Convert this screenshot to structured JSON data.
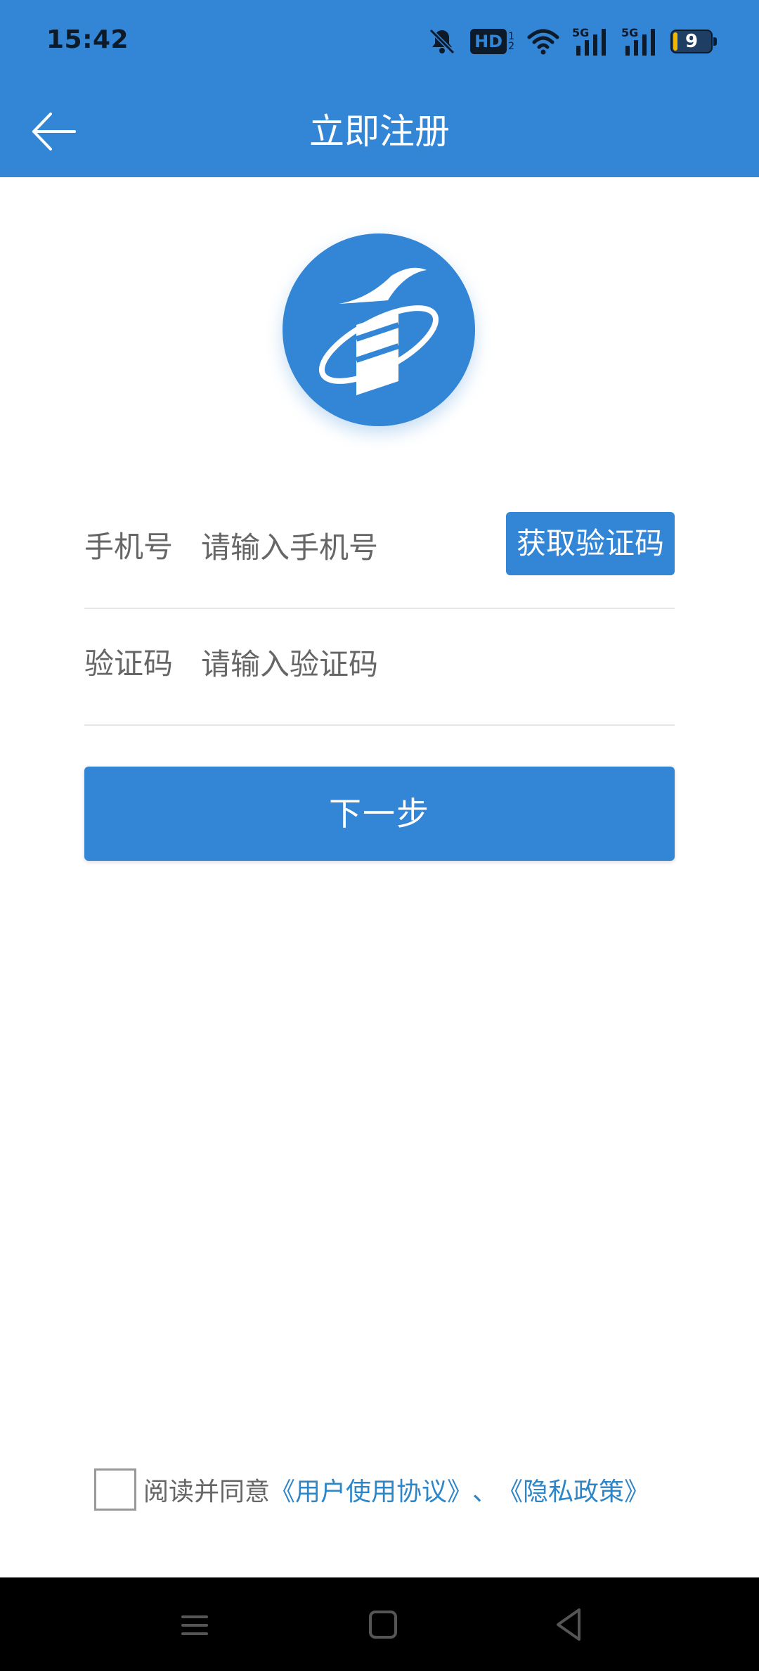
{
  "status_bar": {
    "time": "15:42",
    "battery_level": "9",
    "hd_label": "HD",
    "network_labels": [
      "5G",
      "5G"
    ]
  },
  "header": {
    "title": "立即注册"
  },
  "form": {
    "phone": {
      "label": "手机号",
      "placeholder": "请输入手机号",
      "value": ""
    },
    "code": {
      "label": "验证码",
      "placeholder": "请输入验证码",
      "value": ""
    },
    "get_code_label": "获取验证码",
    "next_label": "下一步"
  },
  "agreement": {
    "prefix": "阅读并同意",
    "user_agreement": "《用户使用协议》",
    "separator": "、",
    "privacy_policy": "《隐私政策》",
    "checked": false
  },
  "colors": {
    "primary": "#3385d6",
    "link": "#2d86c8",
    "battery": "#f2b705"
  }
}
